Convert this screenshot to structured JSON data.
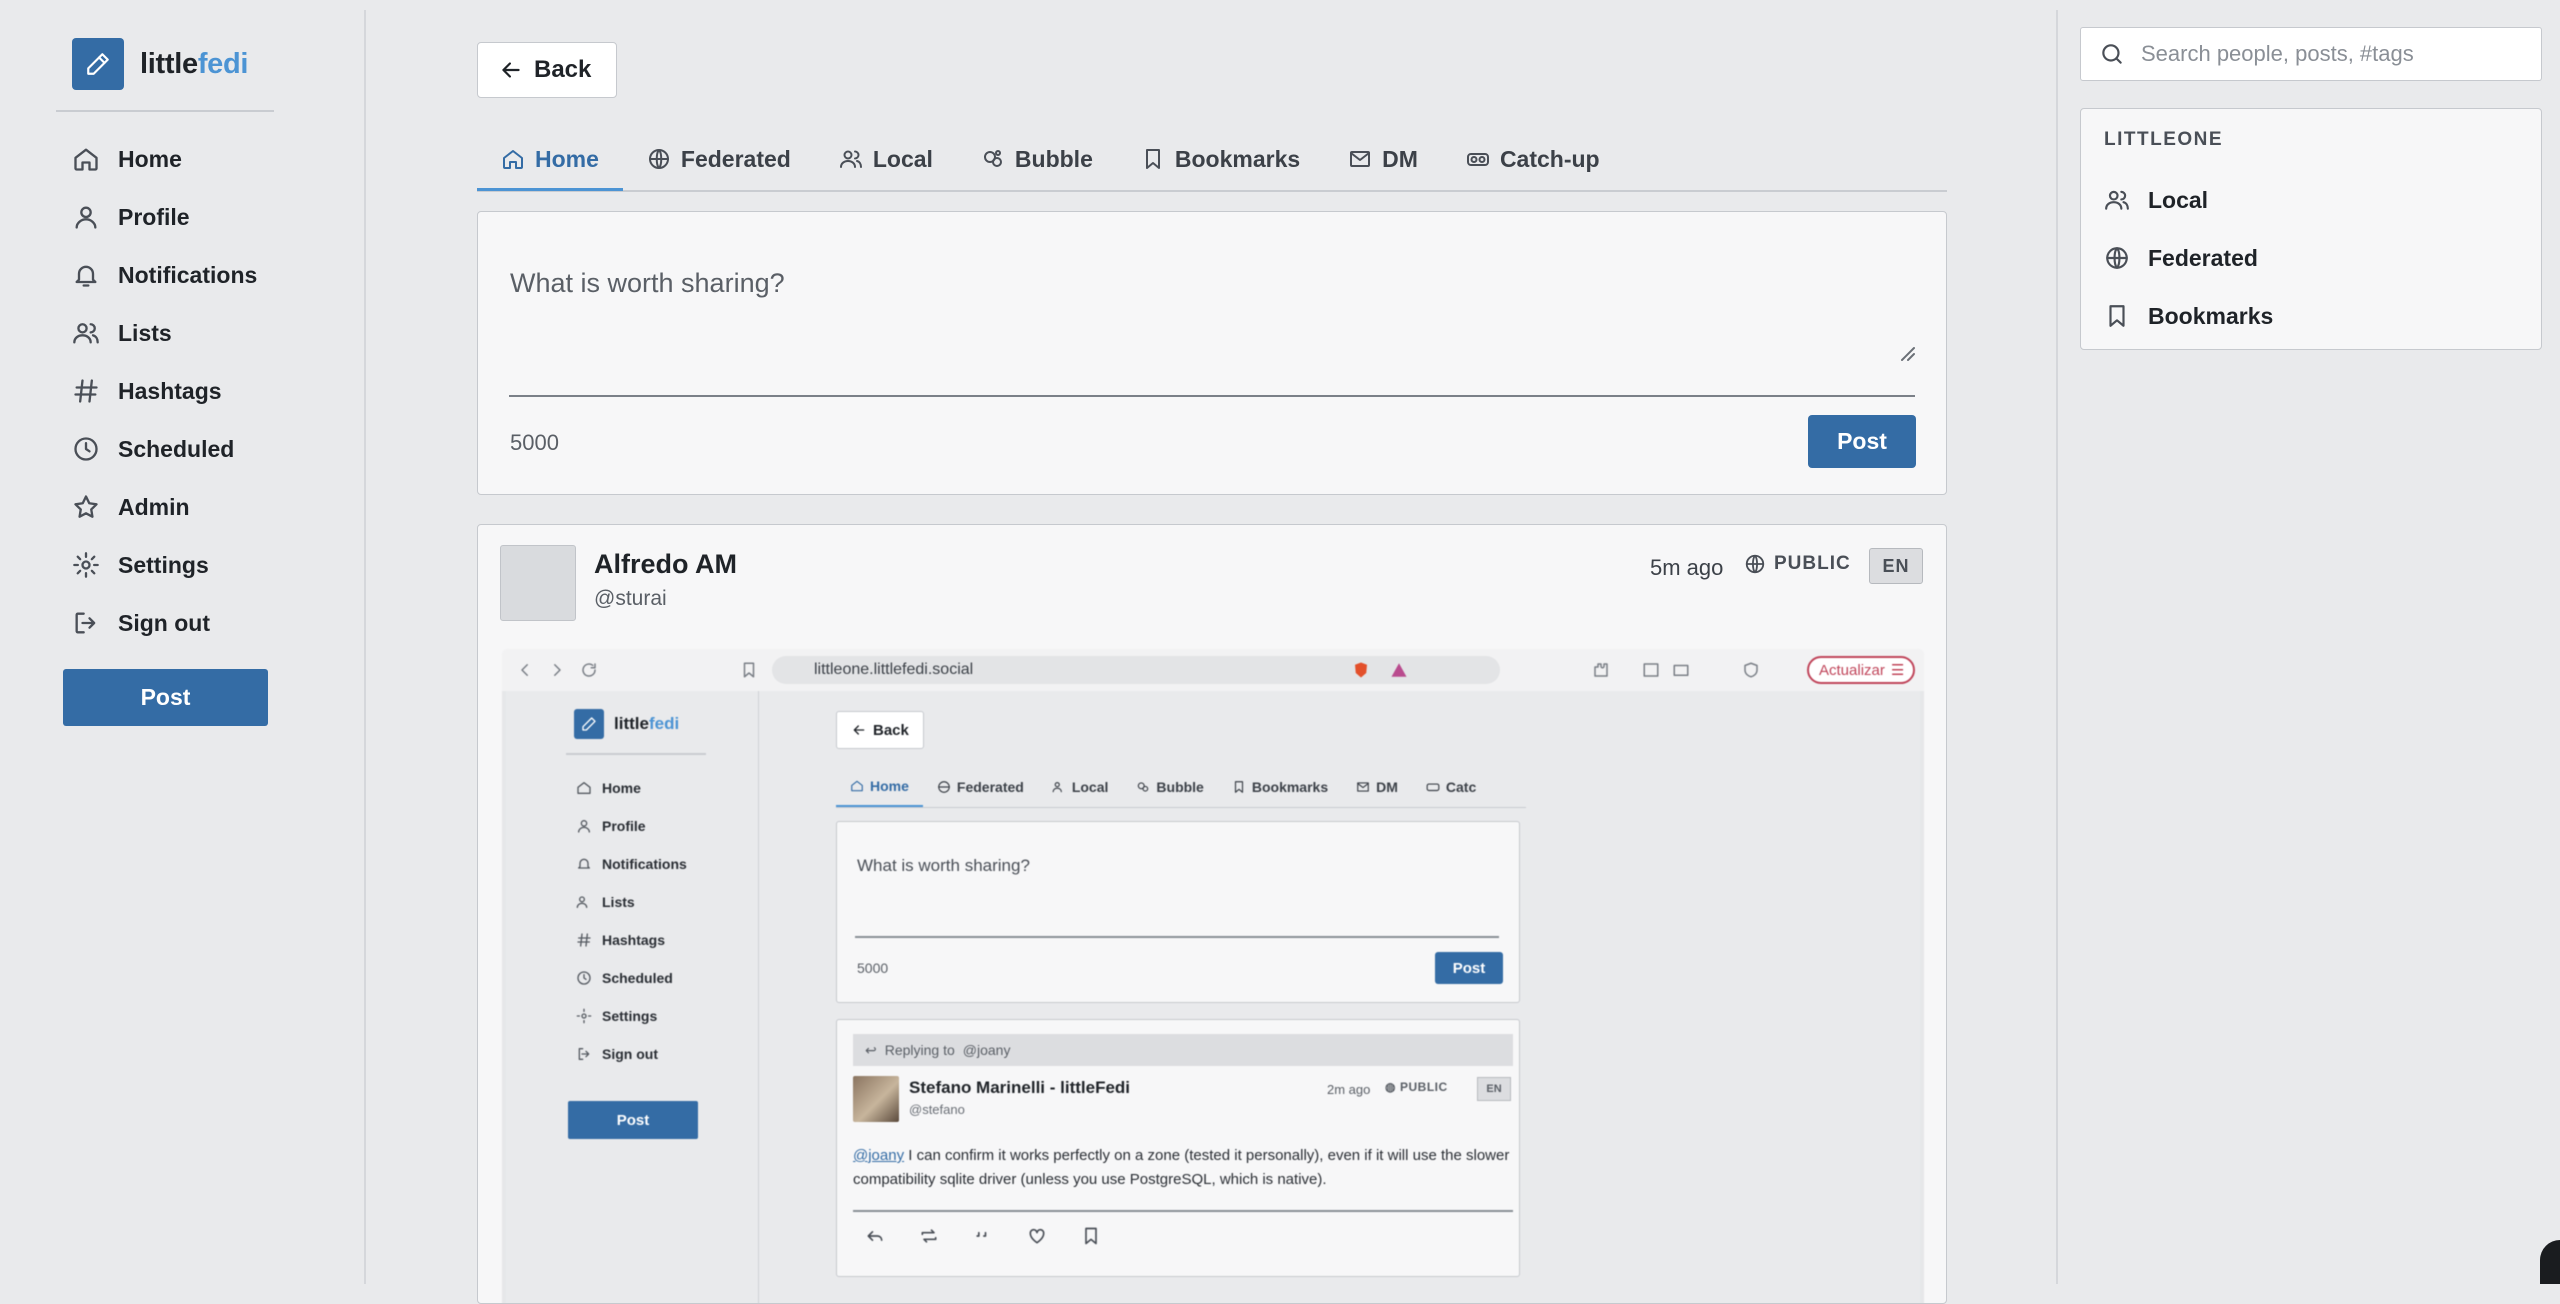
{
  "brand": {
    "name_part1": "little",
    "name_part2": "fedi",
    "accent": "#346ca5",
    "accent_light": "#4c94d4"
  },
  "sidebar": {
    "items": [
      {
        "label": "Home",
        "icon": "home-icon"
      },
      {
        "label": "Profile",
        "icon": "user-icon"
      },
      {
        "label": "Notifications",
        "icon": "bell-icon"
      },
      {
        "label": "Lists",
        "icon": "users-icon"
      },
      {
        "label": "Hashtags",
        "icon": "hash-icon"
      },
      {
        "label": "Scheduled",
        "icon": "clock-icon"
      },
      {
        "label": "Admin",
        "icon": "star-icon"
      },
      {
        "label": "Settings",
        "icon": "gear-icon"
      },
      {
        "label": "Sign out",
        "icon": "sign-out-icon"
      }
    ],
    "post_label": "Post"
  },
  "main": {
    "back_label": "Back",
    "tabs": [
      {
        "label": "Home",
        "icon": "home-icon",
        "active": true
      },
      {
        "label": "Federated",
        "icon": "globe-icon"
      },
      {
        "label": "Local",
        "icon": "users-icon"
      },
      {
        "label": "Bubble",
        "icon": "bubble-icon"
      },
      {
        "label": "Bookmarks",
        "icon": "bookmark-icon"
      },
      {
        "label": "DM",
        "icon": "mail-icon"
      },
      {
        "label": "Catch-up",
        "icon": "goggles-icon"
      }
    ],
    "composer": {
      "placeholder": "What is worth sharing?",
      "char_count": "5000",
      "post_label": "Post"
    },
    "post": {
      "author": "Alfredo AM",
      "handle": "@sturai",
      "time": "5m ago",
      "visibility": "PUBLIC",
      "lang": "EN",
      "screenshot": {
        "url": "littleone.littlefedi.social",
        "update_label": "Actualizar",
        "brand_part1": "little",
        "brand_part2": "fedi",
        "nav": [
          "Home",
          "Profile",
          "Notifications",
          "Lists",
          "Hashtags",
          "Scheduled",
          "Settings",
          "Sign out"
        ],
        "post_label": "Post",
        "back_label": "Back",
        "tabs": [
          "Home",
          "Federated",
          "Local",
          "Bubble",
          "Bookmarks",
          "DM",
          "Catc"
        ],
        "composer_placeholder": "What is worth sharing?",
        "composer_count": "5000",
        "composer_post": "Post",
        "reply": {
          "replying_to_label": "Replying to",
          "replying_to": "@joany",
          "author": "Stefano Marinelli - littleFedi",
          "handle": "@stefano",
          "time": "2m ago",
          "visibility": "PUBLIC",
          "lang": "EN",
          "mention": "@joany",
          "body": " I can confirm it works perfectly on a zone (tested it personally), even if it will use the slower compatibility sqlite driver (unless you use PostgreSQL, which is native)."
        }
      }
    }
  },
  "right": {
    "search_placeholder": "Search people, posts, #tags",
    "instance_title": "LITTLEONE",
    "links": [
      {
        "label": "Local",
        "icon": "users-icon"
      },
      {
        "label": "Federated",
        "icon": "globe-icon"
      },
      {
        "label": "Bookmarks",
        "icon": "bookmark-icon"
      }
    ]
  }
}
